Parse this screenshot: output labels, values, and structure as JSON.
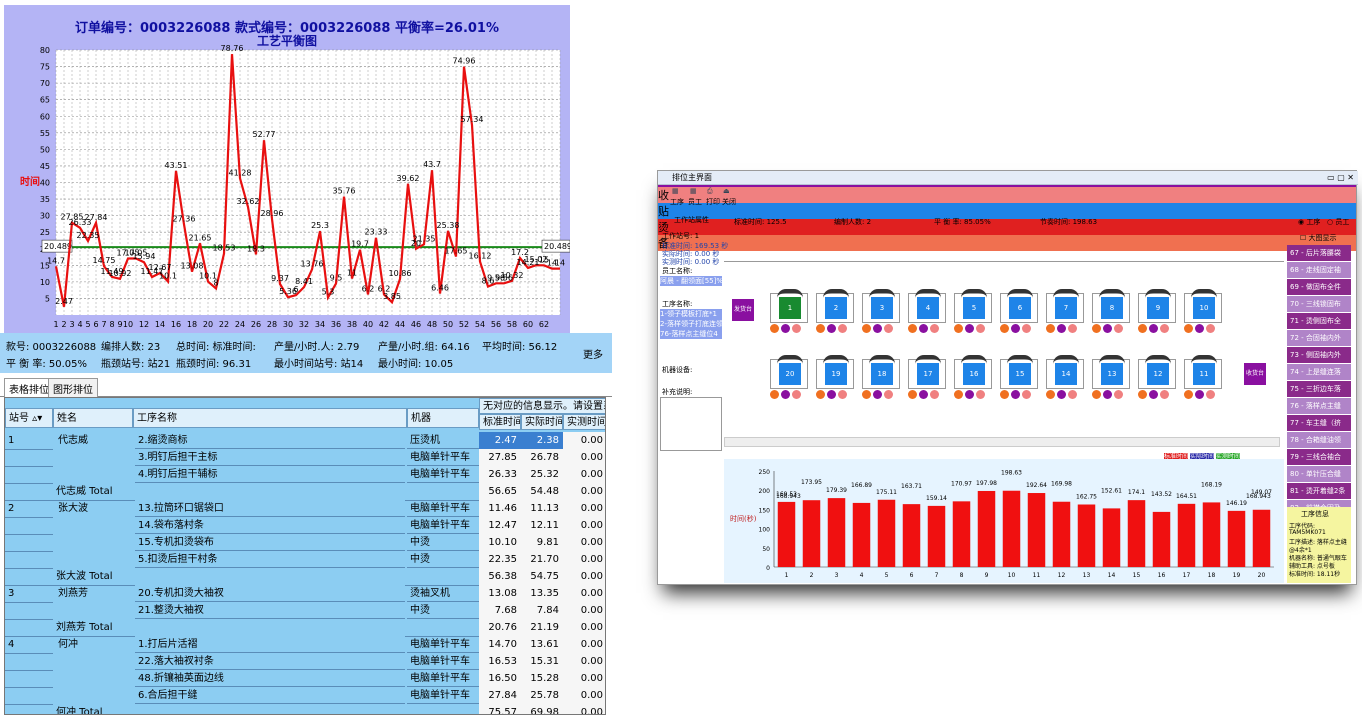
{
  "left_panel": {
    "chart": {
      "header": "订单编号：0003226088   款式编号：0003226088   平衡率=26.01%",
      "subtitle": "工艺平衡图",
      "ylabel": "时间",
      "ref_label": "20.489",
      "ref_label_right": "20.489"
    },
    "summary": {
      "row1": [
        "款号: 0003226088",
        "编排人数: 23",
        "总时间: 标准时间:",
        "产量/小时.人: 2.79",
        "产量/小时.组: 64.16",
        "平均时间: 56.12"
      ],
      "row2": [
        "平 衡 率: 50.05%",
        "瓶颈站号: 站21",
        "瓶颈时间: 96.31",
        "最小时间站号: 站14",
        "最小时间: 10.05"
      ],
      "more": "更多"
    },
    "tabs": [
      "表格排位",
      "图形排位"
    ],
    "grid": {
      "banner": "无对应的信息显示。请设置系统",
      "headers": [
        "站号",
        "姓名",
        "工序名称",
        "机器",
        "标准时间",
        "实际时间",
        "实测时间"
      ],
      "rows": [
        {
          "station": "1",
          "name": "代志威",
          "proc": "2.缩烫商标",
          "machine": "压烫机",
          "std": "2.47",
          "act": "2.38",
          "meas": "0.00",
          "sel": true
        },
        {
          "station": "",
          "name": "",
          "proc": "3.明钉后担干主标",
          "machine": "电脑单针平车",
          "std": "27.85",
          "act": "26.78",
          "meas": "0.00"
        },
        {
          "station": "",
          "name": "",
          "proc": "4.明钉后担干辅标",
          "machine": "电脑单针平车",
          "std": "26.33",
          "act": "25.32",
          "meas": "0.00"
        },
        {
          "station": "",
          "name": "代志威 Total",
          "proc": "",
          "machine": "",
          "std": "56.65",
          "act": "54.48",
          "meas": "0.00",
          "total": true
        },
        {
          "station": "2",
          "name": "张大波",
          "proc": "13.拉筒环口锯袋口",
          "machine": "电脑单针平车",
          "std": "11.46",
          "act": "11.13",
          "meas": "0.00"
        },
        {
          "station": "",
          "name": "",
          "proc": "14.袋布落村条",
          "machine": "电脑单针平车",
          "std": "12.47",
          "act": "12.11",
          "meas": "0.00"
        },
        {
          "station": "",
          "name": "",
          "proc": "15.专机扣烫袋布",
          "machine": "中烫",
          "std": "10.10",
          "act": "9.81",
          "meas": "0.00"
        },
        {
          "station": "",
          "name": "",
          "proc": "5.扣烫后担干村条",
          "machine": "中烫",
          "std": "22.35",
          "act": "21.70",
          "meas": "0.00"
        },
        {
          "station": "",
          "name": "张大波 Total",
          "proc": "",
          "machine": "",
          "std": "56.38",
          "act": "54.75",
          "meas": "0.00",
          "total": true
        },
        {
          "station": "3",
          "name": "刘燕芳",
          "proc": "20.专机扣烫大袖衩",
          "machine": "烫袖叉机",
          "std": "13.08",
          "act": "13.35",
          "meas": "0.00"
        },
        {
          "station": "",
          "name": "",
          "proc": "21.整烫大袖衩",
          "machine": "中烫",
          "std": "7.68",
          "act": "7.84",
          "meas": "0.00"
        },
        {
          "station": "",
          "name": "刘燕芳 Total",
          "proc": "",
          "machine": "",
          "std": "20.76",
          "act": "21.19",
          "meas": "0.00",
          "total": true
        },
        {
          "station": "4",
          "name": "何冲",
          "proc": "1.打后片活褶",
          "machine": "电脑单针平车",
          "std": "14.70",
          "act": "13.61",
          "meas": "0.00"
        },
        {
          "station": "",
          "name": "",
          "proc": "22.落大袖衩衬条",
          "machine": "电脑单针平车",
          "std": "16.53",
          "act": "15.31",
          "meas": "0.00"
        },
        {
          "station": "",
          "name": "",
          "proc": "48.折镶袖英面边线",
          "machine": "电脑单针平车",
          "std": "16.50",
          "act": "15.28",
          "meas": "0.00"
        },
        {
          "station": "",
          "name": "",
          "proc": "6.合后担干缝",
          "machine": "电脑单针平车",
          "std": "27.84",
          "act": "25.78",
          "meas": "0.00"
        },
        {
          "station": "",
          "name": "何冲 Total",
          "proc": "",
          "machine": "",
          "std": "75.57",
          "act": "69.98",
          "meas": "0.00",
          "total": true
        }
      ]
    }
  },
  "right_panel": {
    "window_title": "排位主界面",
    "toolbar": [
      "工序",
      "员工",
      "打印",
      "关闭"
    ],
    "work_attr_title": "工作站属性",
    "stats": [
      "标准时间: 125.5",
      "编制人数: 2",
      "平 衡 率: 85.05%",
      "节奏时间: 198.63"
    ],
    "radio": [
      "工序",
      "员工"
    ],
    "big_chart_check": "大图显示",
    "info": {
      "station": "工作站号: 1",
      "l1": "标准时间: 169.53 秒",
      "l2": "实际时间: 0.00 秒",
      "l3": "实测时间: 0.00 秒",
      "emp": "员工名称:",
      "emp_val": "阿晨 - 翻领面[55]%",
      "proc_title": "工序名称:",
      "procs": [
        "1-领子模板打底*1",
        "2-落样领子打底连领",
        "76-落样点主缝位4"
      ],
      "machine": "机器设备:",
      "remark": "补充说明:"
    },
    "color_buttons": [
      {
        "label": "发",
        "color": "#8a10a0"
      },
      {
        "label": "收",
        "color": "#f08080"
      },
      {
        "label": "贴",
        "color": "#1e84e8"
      },
      {
        "label": "烫",
        "color": "#e02020"
      },
      {
        "label": "备",
        "color": "#f07050"
      }
    ],
    "stations_top": [
      "1",
      "2",
      "3",
      "4",
      "5",
      "6",
      "7",
      "8",
      "9",
      "10"
    ],
    "stations_bottom": [
      "20",
      "19",
      "18",
      "17",
      "16",
      "15",
      "14",
      "13",
      "12",
      "11"
    ],
    "send_label": "发货台",
    "recv_label": "收货台",
    "legend": [
      "标准时间",
      "实际时间",
      "实测时间"
    ],
    "procs_list": [
      "67 - 后片落腰袋",
      "68 - 走线固定袖",
      "69 - 做固布全件",
      "70 - 三线锁固布",
      "71 - 烫侧固布全",
      "72 - 合固袖内外",
      "73 - 侧固袖内外",
      "74 - 上是缝连落",
      "75 - 三折边车落",
      "76 - 落样点主缝",
      "77 - 车主缝（挤",
      "78 - 合箱缝油领",
      "79 - 三线合袖合",
      "80 - 单针压合缝",
      "81 - 烫开着缝2条",
      "82 - 前襟合固及"
    ],
    "proc_info": {
      "title": "工序信息",
      "code": "工序代码:",
      "code_val": "TAM5MK071",
      "desc": "工序描述: 落样点主缝",
      "desc2": "@4余*1",
      "machine": "机器名称: 普通气眼车",
      "tool": "辅助工具: 点号板",
      "time": "标准时间: 18.11秒"
    }
  },
  "chart_data": [
    {
      "type": "line",
      "title": "订单编号：0003226088   款式编号：0003226088   平衡率=26.01%",
      "subtitle": "工艺平衡图",
      "xlabel": "",
      "ylabel": "时间",
      "ylim": [
        0,
        80
      ],
      "xlim": [
        1,
        64
      ],
      "reference_line": 20.489,
      "x": [
        1,
        2,
        3,
        4,
        5,
        6,
        7,
        8,
        9,
        10,
        11,
        12,
        13,
        14,
        15,
        16,
        17,
        18,
        19,
        20,
        21,
        22,
        23,
        24,
        25,
        26,
        27,
        28,
        29,
        30,
        31,
        32,
        33,
        34,
        35,
        36,
        37,
        38,
        39,
        40,
        41,
        42,
        43,
        44,
        45,
        46,
        47,
        48,
        49,
        50,
        51,
        52,
        53,
        54,
        55,
        56,
        57,
        58,
        59,
        60,
        61,
        62,
        63,
        64
      ],
      "values": [
        14.7,
        2.47,
        27.85,
        26.33,
        22.35,
        27.84,
        14.75,
        11.49,
        10.92,
        17.05,
        17.05,
        15.94,
        11.47,
        12.67,
        10.1,
        43.51,
        27.36,
        13.08,
        21.65,
        10.1,
        8.0,
        18.53,
        78.76,
        41.28,
        32.62,
        18.3,
        52.77,
        28.96,
        9.37,
        5.36,
        6.0,
        8.41,
        13.76,
        25.3,
        5.3,
        9.5,
        35.76,
        11.0,
        19.7,
        6.2,
        23.33,
        6.2,
        3.85,
        10.86,
        39.62,
        20.0,
        21.35,
        43.7,
        6.46,
        25.38,
        17.65,
        74.96,
        57.34,
        16.12,
        8.6,
        9.56,
        9.56,
        10.32,
        17.2,
        14.21,
        15.02,
        15.0,
        14.0,
        14.0
      ],
      "color": "#e81010",
      "ref_color": "#1a8a1a"
    },
    {
      "type": "bar",
      "ylabel": "时间(秒)",
      "ylim": [
        0,
        250
      ],
      "categories": [
        "1",
        "2",
        "3",
        "4",
        "5",
        "6",
        "7",
        "8",
        "9",
        "10",
        "11",
        "12",
        "13",
        "14",
        "15",
        "16",
        "17",
        "18",
        "19",
        "20"
      ],
      "values": [
        169.53,
        173.95,
        179.39,
        166.89,
        175.11,
        163.71,
        159.14,
        170.97,
        197.98,
        198.63,
        192.64,
        169.98,
        162.75,
        152.61,
        174.1,
        143.52,
        164.51,
        168.19,
        146.19,
        149.07
      ],
      "labels": [
        "169.53",
        "173.95",
        "179.39",
        "166.89",
        "175.11",
        "163.71",
        "159.14",
        "170.97",
        "197.98",
        "198.63",
        "192.64",
        "169.98",
        "162.75",
        "152.61",
        "174.1",
        "143.52",
        "164.51",
        "168.19",
        "146.19",
        "149.07"
      ],
      "extra_labels": [
        "168.943",
        "168.943"
      ],
      "color": "#f01010"
    }
  ]
}
